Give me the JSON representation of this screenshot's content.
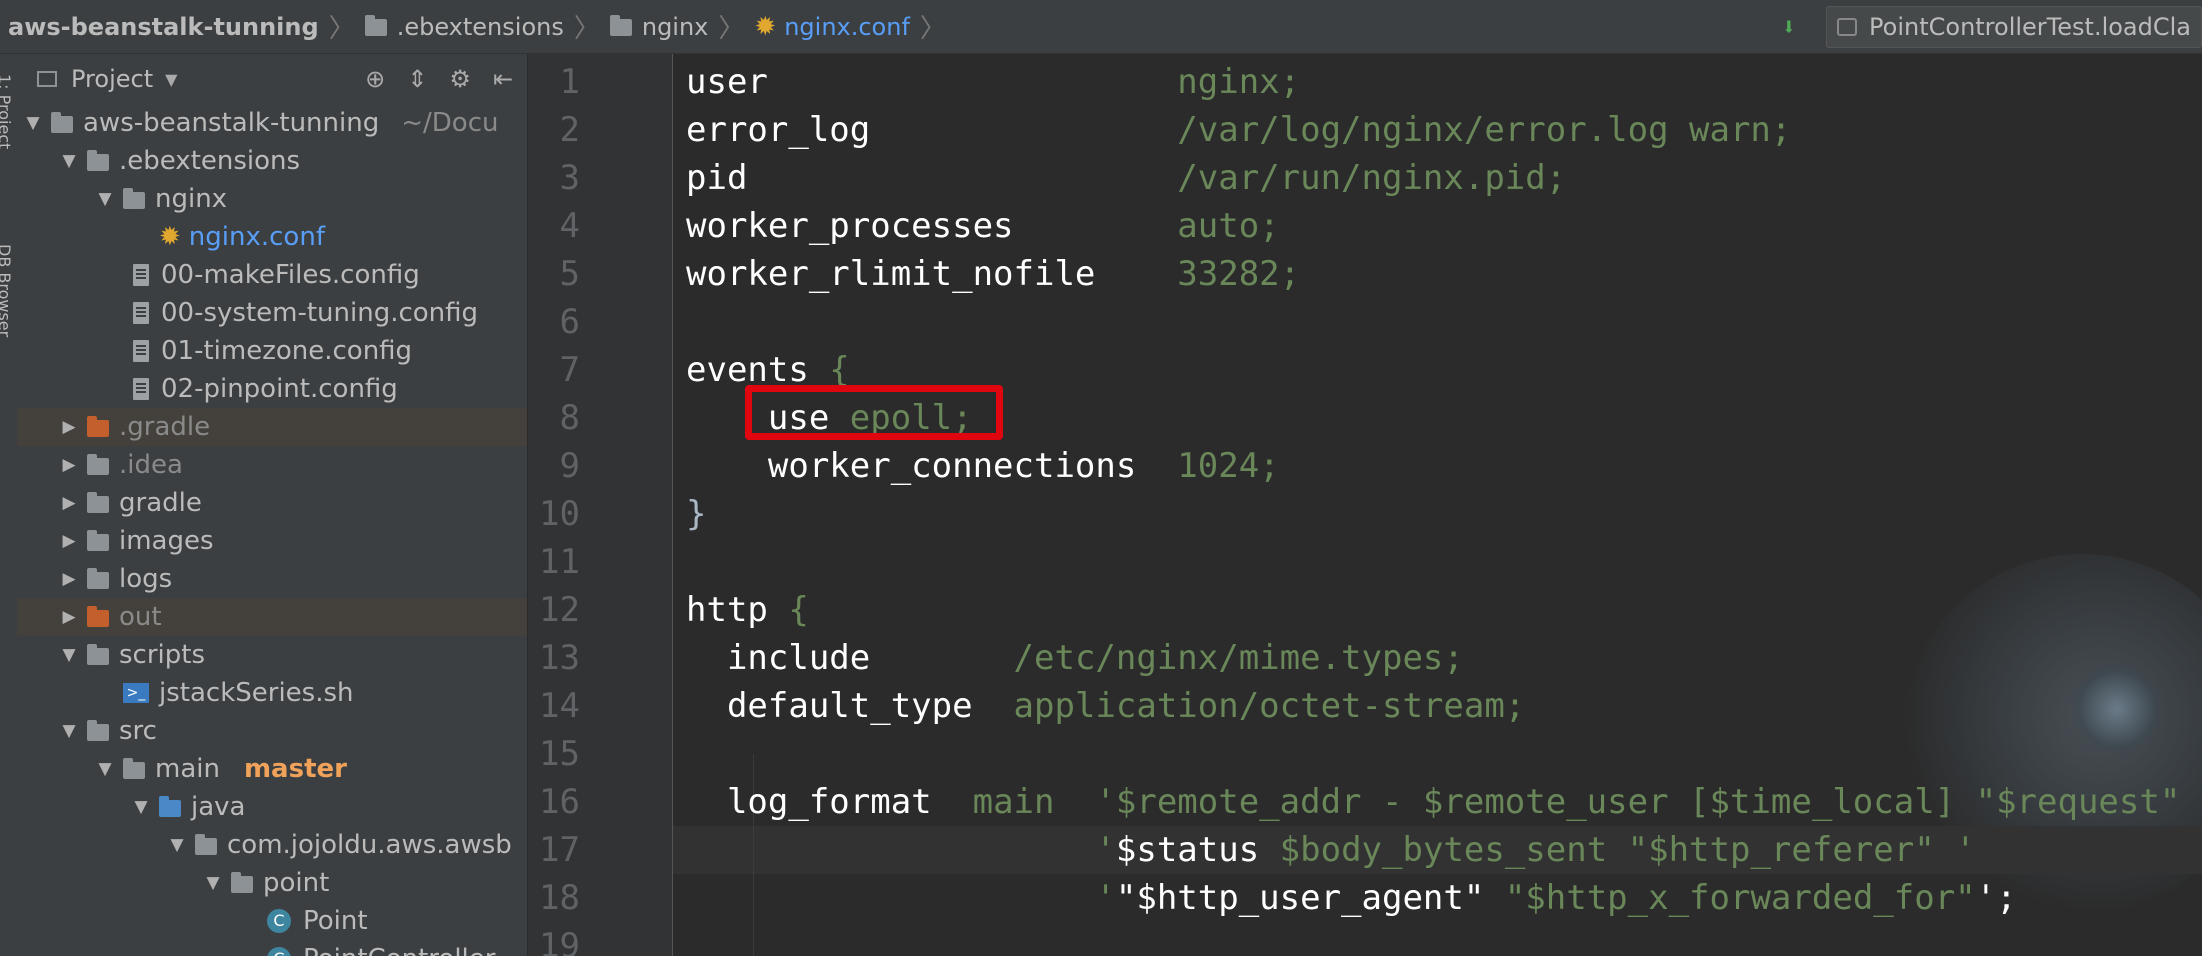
{
  "breadcrumb": {
    "items": [
      {
        "label": "aws-beanstalk-tunning",
        "icon": "project-folder-icon"
      },
      {
        "label": ".ebextensions",
        "icon": "folder-icon"
      },
      {
        "label": "nginx",
        "icon": "folder-icon"
      },
      {
        "label": "nginx.conf",
        "icon": "nginx-config-icon"
      }
    ],
    "separator": "〉"
  },
  "toolbar": {
    "vcs_icon_glyph": "⬇",
    "run_config": "PointControllerTest.loadCla"
  },
  "side_tabs": {
    "project": "1: Project",
    "db_browser": "DB Browser"
  },
  "project_panel": {
    "title": "Project",
    "tools": {
      "locate": "⊕",
      "collapse": "⇕",
      "settings": "⚙",
      "hide": "⇤"
    },
    "tree": [
      {
        "depth": 0,
        "arrow": "▼",
        "icon": "project-folder-icon",
        "label": "aws-beanstalk-tunning",
        "hint": "~/Docu"
      },
      {
        "depth": 1,
        "arrow": "▼",
        "icon": "folder-icon",
        "label": ".ebextensions"
      },
      {
        "depth": 2,
        "arrow": "▼",
        "icon": "folder-icon",
        "label": "nginx"
      },
      {
        "depth": 3,
        "arrow": "",
        "icon": "nginx-config-icon",
        "label": "nginx.conf",
        "active": true
      },
      {
        "depth": 3,
        "arrow": "",
        "icon": "file-icon",
        "label": "00-makeFiles.config",
        "shift": -1
      },
      {
        "depth": 3,
        "arrow": "",
        "icon": "file-icon",
        "label": "00-system-tuning.config",
        "shift": -1
      },
      {
        "depth": 3,
        "arrow": "",
        "icon": "file-icon",
        "label": "01-timezone.config",
        "shift": -1
      },
      {
        "depth": 3,
        "arrow": "",
        "icon": "file-icon",
        "label": "02-pinpoint.config",
        "shift": -1
      },
      {
        "depth": 1,
        "arrow": "▶",
        "icon": "excluded-folder-icon",
        "label": ".gradle",
        "excluded": true
      },
      {
        "depth": 1,
        "arrow": "▶",
        "icon": "folder-icon",
        "label": ".idea",
        "dim": true
      },
      {
        "depth": 1,
        "arrow": "▶",
        "icon": "folder-icon",
        "label": "gradle"
      },
      {
        "depth": 1,
        "arrow": "▶",
        "icon": "folder-icon",
        "label": "images"
      },
      {
        "depth": 1,
        "arrow": "▶",
        "icon": "folder-icon",
        "label": "logs"
      },
      {
        "depth": 1,
        "arrow": "▶",
        "icon": "excluded-folder-icon",
        "label": "out",
        "excluded": true
      },
      {
        "depth": 1,
        "arrow": "▼",
        "icon": "folder-icon",
        "label": "scripts"
      },
      {
        "depth": 2,
        "arrow": "",
        "icon": "shell-script-icon",
        "label": "jstackSeries.sh"
      },
      {
        "depth": 1,
        "arrow": "▼",
        "icon": "folder-icon",
        "label": "src"
      },
      {
        "depth": 2,
        "arrow": "▼",
        "icon": "module-folder-icon",
        "label": "main",
        "branch": "master"
      },
      {
        "depth": 3,
        "arrow": "▼",
        "icon": "source-folder-icon",
        "label": "java"
      },
      {
        "depth": 4,
        "arrow": "▼",
        "icon": "package-icon",
        "label": "com.jojoldu.aws.awsb"
      },
      {
        "depth": 5,
        "arrow": "▼",
        "icon": "package-icon",
        "label": "point"
      },
      {
        "depth": 6,
        "arrow": "",
        "icon": "class-icon",
        "label": "Point"
      },
      {
        "depth": 6,
        "arrow": "",
        "icon": "class-icon",
        "label": "PointController"
      }
    ]
  },
  "editor": {
    "current_line": 17,
    "highlighted_line": 8,
    "lines": [
      {
        "n": "1",
        "indent": "",
        "tokens": [
          {
            "t": "k",
            "s": "user                    "
          },
          {
            "t": "v",
            "s": "nginx;"
          }
        ]
      },
      {
        "n": "2",
        "indent": "",
        "tokens": [
          {
            "t": "k",
            "s": "error_log               "
          },
          {
            "t": "v",
            "s": "/var/log/nginx/error.log warn;"
          }
        ]
      },
      {
        "n": "3",
        "indent": "",
        "tokens": [
          {
            "t": "k",
            "s": "pid                     "
          },
          {
            "t": "v",
            "s": "/var/run/nginx.pid;"
          }
        ]
      },
      {
        "n": "4",
        "indent": "",
        "tokens": [
          {
            "t": "k",
            "s": "worker_processes        "
          },
          {
            "t": "v",
            "s": "auto;"
          }
        ]
      },
      {
        "n": "5",
        "indent": "",
        "tokens": [
          {
            "t": "k",
            "s": "worker_rlimit_nofile    "
          },
          {
            "t": "v",
            "s": "33282;"
          }
        ]
      },
      {
        "n": "6",
        "indent": "",
        "tokens": []
      },
      {
        "n": "7",
        "indent": "",
        "tokens": [
          {
            "t": "k",
            "s": "events "
          },
          {
            "t": "v",
            "s": "{"
          }
        ]
      },
      {
        "n": "8",
        "indent": "    ",
        "tokens": [
          {
            "t": "k",
            "s": "use "
          },
          {
            "t": "v",
            "s": "epoll;"
          }
        ]
      },
      {
        "n": "9",
        "indent": "    ",
        "tokens": [
          {
            "t": "k",
            "s": "worker_connections  "
          },
          {
            "t": "v",
            "s": "1024;"
          }
        ]
      },
      {
        "n": "10",
        "indent": "",
        "tokens": [
          {
            "t": "p",
            "s": "}"
          }
        ]
      },
      {
        "n": "11",
        "indent": "",
        "tokens": []
      },
      {
        "n": "12",
        "indent": "",
        "tokens": [
          {
            "t": "k",
            "s": "http "
          },
          {
            "t": "v",
            "s": "{"
          }
        ]
      },
      {
        "n": "13",
        "indent": "  ",
        "tokens": [
          {
            "t": "k",
            "s": "include       "
          },
          {
            "t": "v",
            "s": "/etc/nginx/mime.types;"
          }
        ]
      },
      {
        "n": "14",
        "indent": "  ",
        "tokens": [
          {
            "t": "k",
            "s": "default_type  "
          },
          {
            "t": "v",
            "s": "application/octet-stream;"
          }
        ]
      },
      {
        "n": "15",
        "indent": "",
        "tokens": []
      },
      {
        "n": "16",
        "indent": "  ",
        "tokens": [
          {
            "t": "k",
            "s": "log_format  "
          },
          {
            "t": "v",
            "s": "main  '$remote_addr - $remote_user [$time_local] \"$request\" '"
          }
        ]
      },
      {
        "n": "17",
        "indent": "                    ",
        "tokens": [
          {
            "t": "v",
            "s": "'"
          },
          {
            "t": "k",
            "s": "$status "
          },
          {
            "t": "v",
            "s": "$body_bytes_sent \"$http_referer\" '"
          }
        ]
      },
      {
        "n": "18",
        "indent": "                    ",
        "tokens": [
          {
            "t": "v",
            "s": "'"
          },
          {
            "t": "k",
            "s": "\"$http_user_agent\" "
          },
          {
            "t": "v",
            "s": "\"$http_x_forwarded_for\""
          },
          {
            "t": "k",
            "s": "';"
          }
        ]
      },
      {
        "n": "19",
        "indent": "",
        "tokens": []
      }
    ]
  },
  "colors": {
    "keyword": "#ffffff",
    "value": "#6a8759",
    "highlight_box": "#e0060f",
    "active_file": "#589df6",
    "branch": "#f0a25a"
  }
}
